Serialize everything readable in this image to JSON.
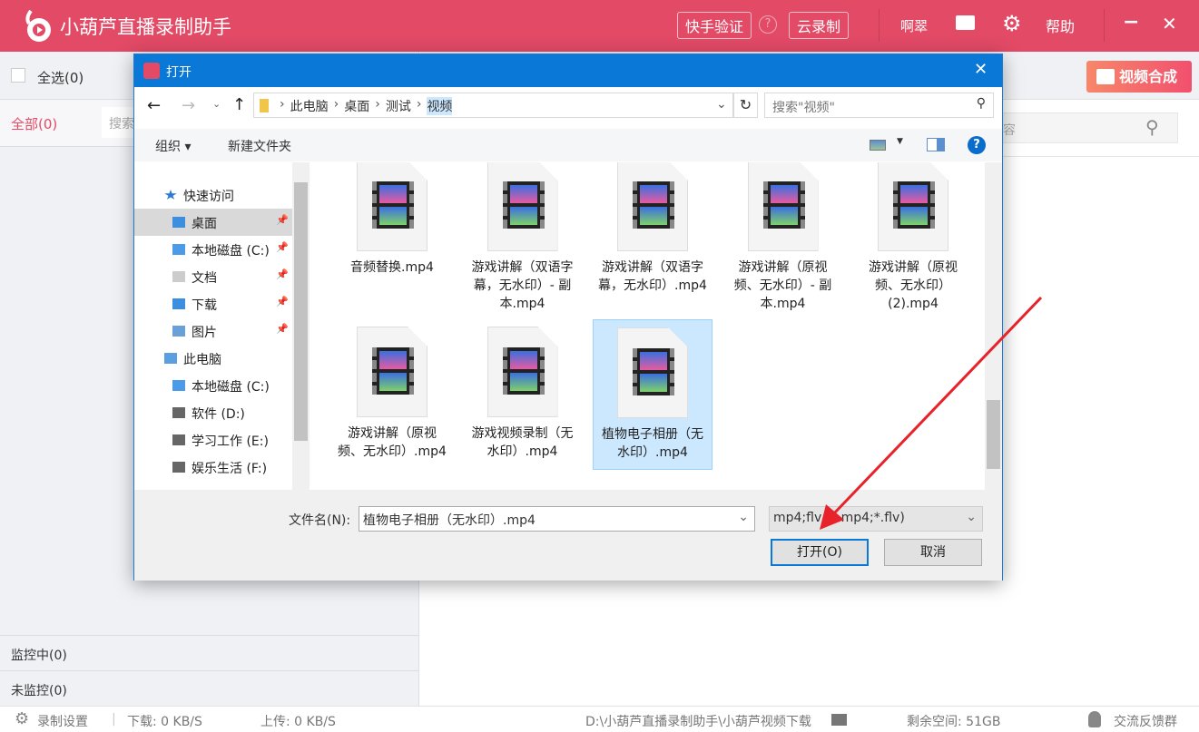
{
  "app": {
    "title": "小葫芦直播录制助手",
    "kuaishou_verify": "快手验证",
    "cloud_record": "云录制",
    "username": "啊翠",
    "help": "帮助",
    "minimize": "−",
    "close": "✕"
  },
  "left": {
    "select_all": "全选(0)",
    "all_tab": "全部(0)",
    "search_placeholder": "搜索",
    "monitoring": "监控中(0)",
    "not_monitoring": "未监控(0)"
  },
  "right": {
    "merge_button": "视频合成",
    "search_placeholder": "容"
  },
  "status": {
    "record_settings": "录制设置",
    "download": "下载: 0 KB/S",
    "upload": "上传: 0 KB/S",
    "path": "D:\\小葫芦直播录制助手\\小葫芦视频下载",
    "free_space": "剩余空间: 51GB",
    "feedback": "交流反馈群"
  },
  "dialog": {
    "title": "打开",
    "breadcrumb": [
      "此电脑",
      "桌面",
      "测试",
      "视频"
    ],
    "search_placeholder": "搜索\"视频\"",
    "organize": "组织 ▾",
    "new_folder": "新建文件夹",
    "nav": [
      {
        "label": "快速访问",
        "level": 0,
        "icon": "star"
      },
      {
        "label": "桌面",
        "level": 1,
        "icon": "folder-blue",
        "pinned": true,
        "selected": true
      },
      {
        "label": "本地磁盘 (C:)",
        "level": 1,
        "icon": "drive-win",
        "pinned": true
      },
      {
        "label": "文档",
        "level": 1,
        "icon": "doc",
        "pinned": true
      },
      {
        "label": "下载",
        "level": 1,
        "icon": "download",
        "pinned": true
      },
      {
        "label": "图片",
        "level": 1,
        "icon": "picture",
        "pinned": true
      },
      {
        "label": "此电脑",
        "level": 0,
        "icon": "pc"
      },
      {
        "label": "本地磁盘 (C:)",
        "level": 1,
        "icon": "drive-win"
      },
      {
        "label": "软件 (D:)",
        "level": 1,
        "icon": "drive"
      },
      {
        "label": "学习工作 (E:)",
        "level": 1,
        "icon": "drive"
      },
      {
        "label": "娱乐生活 (F:)",
        "level": 1,
        "icon": "drive"
      }
    ],
    "files": [
      {
        "name": "音频替换.mp4"
      },
      {
        "name": "游戏讲解（双语字幕，无水印）- 副本.mp4"
      },
      {
        "name": "游戏讲解（双语字幕，无水印）.mp4"
      },
      {
        "name": "游戏讲解（原视频、无水印）- 副本.mp4"
      },
      {
        "name": "游戏讲解（原视频、无水印）(2).mp4"
      },
      {
        "name": "游戏讲解（原视频、无水印）.mp4"
      },
      {
        "name": "游戏视频录制（无水印）.mp4"
      },
      {
        "name": "植物电子相册（无水印）.mp4",
        "selected": true
      }
    ],
    "filename_label": "文件名(N):",
    "filename_value": "植物电子相册（无水印）.mp4",
    "filetype": "mp4;flv (*.mp4;*.flv)",
    "open": "打开(O)",
    "cancel": "取消"
  },
  "colors": {
    "brand": "#e24a66",
    "dialog_title": "#0a78d6",
    "arrow": "#e8222a"
  }
}
